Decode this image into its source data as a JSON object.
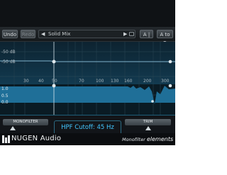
{
  "toolbar": {
    "undo_label": "Undo",
    "redo_label": "Redo",
    "preset_name": "Solid Mix",
    "compare_label": "A | ",
    "copy_label": "A to B"
  },
  "graph": {
    "db_top": "-50 dB",
    "db_mid": "-50 dB",
    "level_labels": [
      "1.0",
      "0.5",
      "0.0"
    ],
    "freq_labels": [
      "30",
      "40",
      "50",
      "70",
      "100",
      "130",
      "160",
      "200",
      "300"
    ]
  },
  "controls": {
    "monofilter_label": "MONOFILTER",
    "trim_label": "TRIM",
    "readout": "HPF Cutoff: 45 Hz"
  },
  "footer": {
    "brand": "NUGEN Audio",
    "product_prefix": "Monofilter ",
    "product_suffix": "elements"
  },
  "colors": {
    "accent": "#42c6ff",
    "panel": "#0f1215",
    "graph_fill": "#1f6f98"
  }
}
